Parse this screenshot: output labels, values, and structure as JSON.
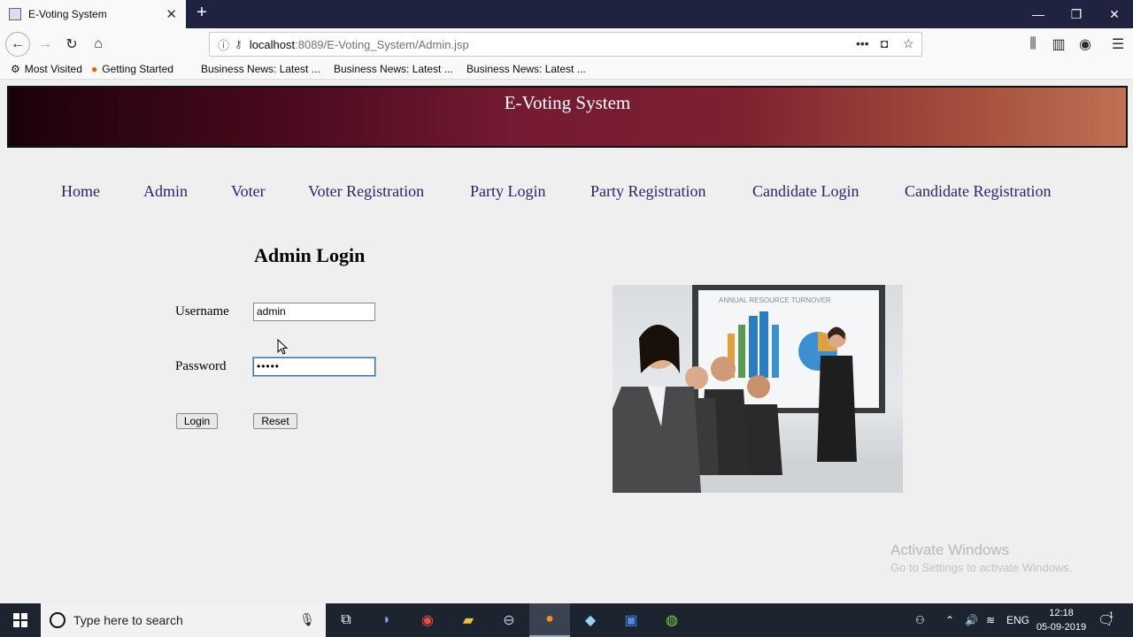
{
  "browser": {
    "tab_title": "E-Voting System",
    "tab_close": "✕",
    "new_tab": "+",
    "window_controls": {
      "minimize": "—",
      "maximize": "❐",
      "close": "✕"
    },
    "url_host": "localhost",
    "url_path": ":8089/E-Voting_System/Admin.jsp",
    "url_actions": {
      "more": "•••",
      "pocket": "◘",
      "bookmark": "☆"
    },
    "toolbar_icons": {
      "library": "⫼",
      "sidebar": "▥",
      "account": "◉",
      "menu": "☰"
    },
    "nav": {
      "back": "←",
      "forward": "→",
      "reload": "↻",
      "home": "⌂"
    },
    "bookmarks": [
      {
        "label": "Most Visited",
        "icon": "gear-icon"
      },
      {
        "label": "Getting Started",
        "icon": "firefox-icon"
      },
      {
        "label": "Business News: Latest ...",
        "icon": ""
      },
      {
        "label": "Business News: Latest ...",
        "icon": ""
      },
      {
        "label": "Business News: Latest ...",
        "icon": ""
      }
    ]
  },
  "page": {
    "banner_title": "E-Voting System",
    "menu": [
      "Home",
      "Admin",
      "Voter",
      "Voter Registration",
      "Party Login",
      "Party Registration",
      "Candidate Login",
      "Candidate Registration"
    ],
    "login": {
      "title": "Admin Login",
      "username_label": "Username",
      "username_value": "admin",
      "password_label": "Password",
      "password_value": "•••••",
      "login_button": "Login",
      "reset_button": "Reset"
    },
    "photo_text": "ANNUAL RESOURCE TURNOVER",
    "watermark": {
      "title": "Activate Windows",
      "subtitle": "Go to Settings to activate Windows."
    }
  },
  "taskbar": {
    "search_placeholder": "Type here to search",
    "language": "ENG",
    "time": "12:18",
    "date": "05-09-2019",
    "notification_count": "1"
  },
  "colors": {
    "menu_link": "#2a1e6e",
    "taskbar": "#1c2430",
    "tab_strip": "#202340"
  }
}
